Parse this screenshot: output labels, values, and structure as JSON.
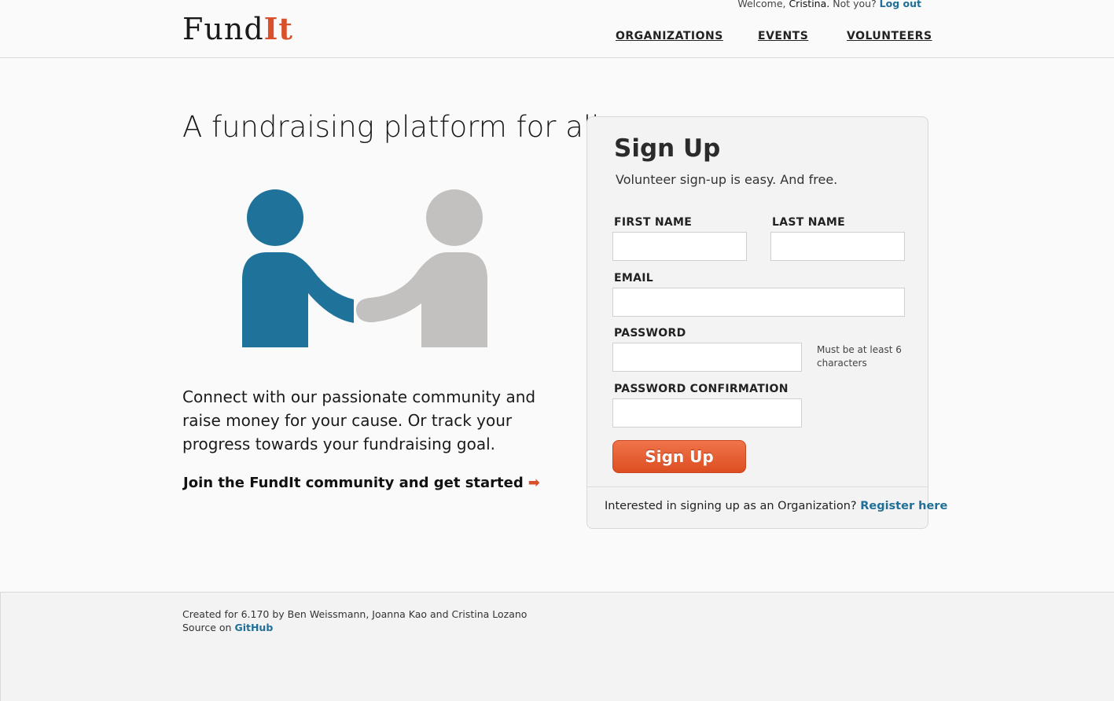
{
  "header": {
    "logo_main": "Fund",
    "logo_accent": "It",
    "welcome_prefix": "Welcome, ",
    "welcome_name": "Cristina.",
    "welcome_question": " Not you? ",
    "logout_label": "Log out",
    "nav": [
      "ORGANIZATIONS",
      "EVENTS",
      "VOLUNTEERS"
    ]
  },
  "hero": {
    "tagline": "A fundraising platform for all.",
    "intro": "Connect with our passionate community and raise money for your cause. Or track your progress towards your fundraising goal.",
    "cta_label": "Join the FundIt community and get started",
    "cta_icon": "arrow-right-icon"
  },
  "signup": {
    "title": "Sign Up",
    "subtitle": "Volunteer sign-up is easy. And free.",
    "first_name_label": "FIRST NAME",
    "first_name_value": "",
    "last_name_label": "LAST NAME",
    "last_name_value": "",
    "email_label": "EMAIL",
    "email_value": "",
    "password_label": "PASSWORD",
    "password_value": "",
    "password_hint": "Must be at least 6 characters",
    "password_confirm_label": "PASSWORD CONFIRMATION",
    "password_confirm_value": "",
    "submit_label": "Sign Up",
    "org_prompt": "Interested in signing up as an Organization?",
    "org_link": "Register here"
  },
  "footer": {
    "credits": "Created for 6.170 by Ben Weissmann, Joanna Kao and Cristina Lozano",
    "source_prefix": "Source on ",
    "source_link": "GitHub"
  },
  "colors": {
    "accent_orange": "#d9502b",
    "link_blue": "#1f6f99",
    "figure_blue": "#1f7299",
    "figure_gray": "#c2c1c0"
  }
}
